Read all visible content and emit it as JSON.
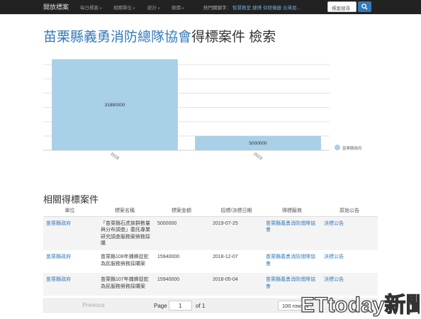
{
  "navbar": {
    "brand": "開放標案",
    "items": [
      {
        "label": "每日標案"
      },
      {
        "label": "相關單位"
      },
      {
        "label": "統計"
      },
      {
        "label": "競價"
      }
    ],
    "hot_label": "熱門關鍵字：",
    "hot_keywords": [
      "智慧教室",
      "捷博",
      "仰德儀器",
      "台灣恩..."
    ],
    "search_placeholder": "標案搜尋"
  },
  "page": {
    "title_org": "苗栗縣義勇消防總隊協會",
    "title_rest": "得標案件 檢索",
    "section_title": "相關得標案件"
  },
  "chart_data": {
    "type": "bar",
    "categories": [
      "2018",
      "2019"
    ],
    "values": [
      31880000,
      5000000
    ],
    "data_labels": [
      "31880000",
      "5000000"
    ],
    "series": [
      {
        "name": "苗栗縣政府",
        "values": [
          31880000,
          5000000
        ]
      }
    ],
    "ylim": [
      0,
      34000000
    ],
    "grid": true,
    "legend": "right",
    "bar_color": "#a8d0e6"
  },
  "table": {
    "headers": [
      "單位",
      "標案名稱",
      "標案金額",
      "招標/決標日期",
      "得標廠商",
      "原始公告"
    ],
    "rows": [
      {
        "unit": "苗栗縣政府",
        "name": "「苗栗縣石虎族群數量與分布調查」委託專業研究調查服務案勞務採購",
        "amount": "5000000",
        "date": "2019-07-25",
        "vendor": "苗栗縣義勇消防總隊協會",
        "notice": "決標公告"
      },
      {
        "unit": "苗栗縣政府",
        "name": "苗栗縣108年捕蜂捉蛇為民服務勞務採購案",
        "amount": "15940000",
        "date": "2018-12-07",
        "vendor": "苗栗縣義勇消防總隊協會",
        "notice": "決標公告"
      },
      {
        "unit": "苗栗縣政府",
        "name": "苗栗縣107年捕蜂捉蛇為民服務勞務採購案",
        "amount": "15940000",
        "date": "2018-05-04",
        "vendor": "苗栗縣義勇消防總隊協會",
        "notice": "決標公告"
      }
    ]
  },
  "pager": {
    "previous": "Previous",
    "page_label": "Page",
    "page_value": "1",
    "of_label": "of 1",
    "rows_value": "100 rows"
  },
  "watermark": {
    "text": "ETtoday新聞雲"
  }
}
